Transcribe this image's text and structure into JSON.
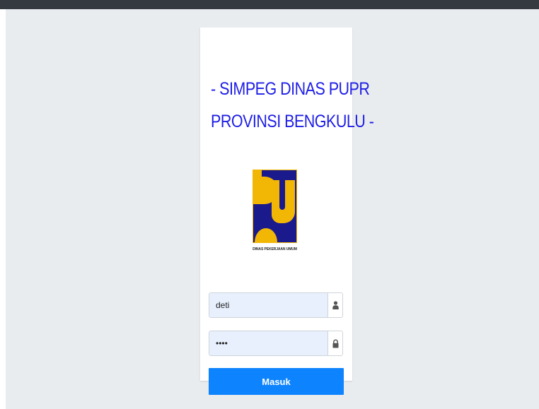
{
  "app": {
    "title_line1": "- SIMPEG DINAS PUPR",
    "title_line2": "PROVINSI BENGKULU -"
  },
  "logo": {
    "caption": "DINAS PEKERJAAN UMUM",
    "colors": {
      "background": "#1a1a8c",
      "shape": "#f2b705"
    }
  },
  "login": {
    "username": {
      "value": "deti",
      "icon": "user-icon"
    },
    "password": {
      "value": "deti",
      "icon": "lock-icon"
    },
    "submit_label": "Masuk"
  },
  "colors": {
    "title": "#1e1ee6",
    "button": "#0d83fd",
    "page_background": "#e9ecef",
    "topbar": "#343a40"
  }
}
